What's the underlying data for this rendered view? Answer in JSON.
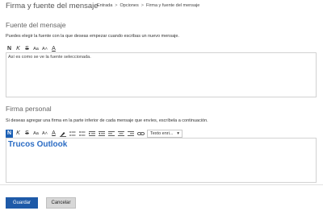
{
  "header": {
    "title": "Firma y fuente del mensaje",
    "breadcrumb": [
      "Entrada",
      "Opciones",
      "Firma y fuente del mensaje"
    ],
    "separator": ">"
  },
  "font_section": {
    "title": "Fuente del mensaje",
    "description": "Puedes elegir la fuente con la que deseas empezar cuando escribas un nuevo mensaje.",
    "toolbar": {
      "bold": "N",
      "italic": "K",
      "strike": "S",
      "font_size": "Aa",
      "grow": "A˄",
      "color": "A"
    },
    "preview_text": "Así es como se ve la fuente seleccionada."
  },
  "signature_section": {
    "title": "Firma personal",
    "description": "Si deseas agregar una firma en la parte inferior de cada mensaje que envíes, escríbela a continuación.",
    "toolbar": {
      "bold": "N",
      "italic": "K",
      "strike": "S",
      "font_size": "Aa",
      "grow": "A˄",
      "color": "A",
      "font_select": "Texto enri...",
      "font_select_arrow": "▾"
    },
    "signature_text": "Trucos Outlook",
    "accent_color": "#2b6cc4"
  },
  "buttons": {
    "save": "Guardar",
    "cancel": "Cancelar"
  },
  "colors": {
    "primary": "#1e5aa8",
    "active_tool": "#1a5fb4"
  }
}
